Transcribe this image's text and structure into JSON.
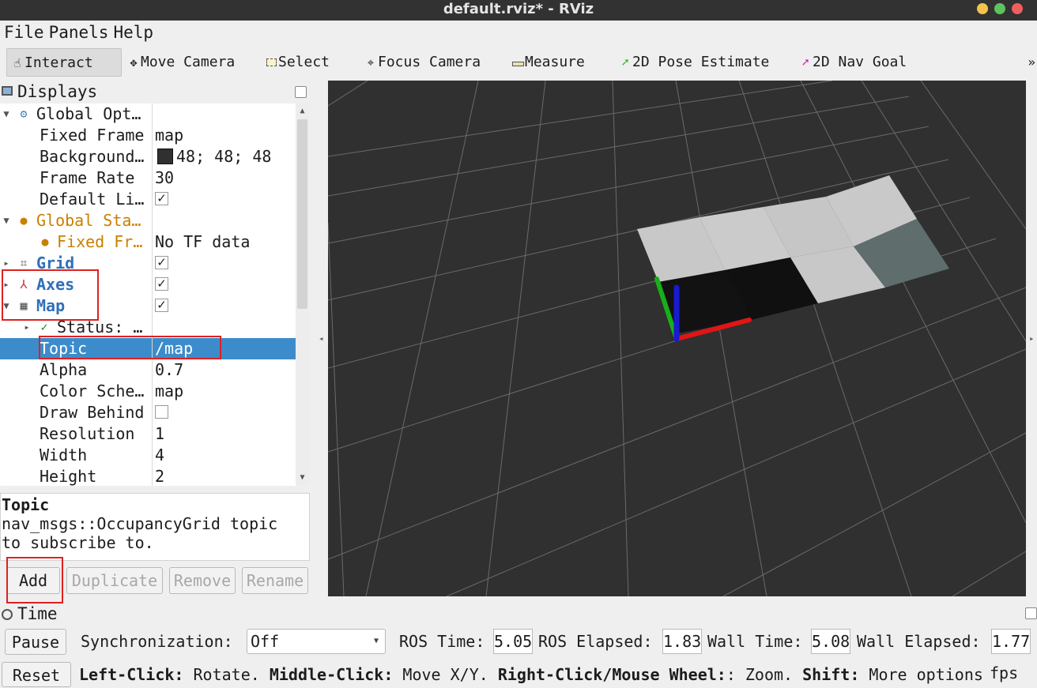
{
  "window": {
    "title": "default.rviz* - RViz"
  },
  "menu": {
    "file_label": "File",
    "panels_label": "Panels",
    "help_label": "Help"
  },
  "toolbar": {
    "interact": "Interact",
    "move_camera": "Move Camera",
    "select": "Select",
    "focus_camera": "Focus Camera",
    "measure": "Measure",
    "pose_estimate": "2D Pose Estimate",
    "nav_goal": "2D Nav Goal",
    "more": "»"
  },
  "displays": {
    "title": "Displays",
    "rows": {
      "global_options": {
        "name": "Global Opt…"
      },
      "fixed_frame": {
        "name": "Fixed Frame",
        "value": "map"
      },
      "background": {
        "name": "Background…",
        "value": "48; 48; 48"
      },
      "frame_rate": {
        "name": "Frame Rate",
        "value": "30"
      },
      "default_light": {
        "name": "Default Li…"
      },
      "global_status": {
        "name": "Global Sta…"
      },
      "fixed_frame_status": {
        "name": "Fixed Fr…",
        "value": "No TF data"
      },
      "grid": {
        "name": "Grid"
      },
      "axes": {
        "name": "Axes"
      },
      "map": {
        "name": "Map"
      },
      "status": {
        "name": "Status: …"
      },
      "topic": {
        "name": "Topic",
        "value": "/map"
      },
      "alpha": {
        "name": "Alpha",
        "value": "0.7"
      },
      "color_scheme": {
        "name": "Color Sche…",
        "value": "map"
      },
      "draw_behind": {
        "name": "Draw Behind"
      },
      "resolution": {
        "name": "Resolution",
        "value": "1"
      },
      "width": {
        "name": "Width",
        "value": "4"
      },
      "height": {
        "name": "Height",
        "value": "2"
      }
    },
    "description": {
      "title": "Topic",
      "text": "nav_msgs::OccupancyGrid topic to subscribe to."
    },
    "buttons": {
      "add": "Add",
      "duplicate": "Duplicate",
      "remove": "Remove",
      "rename": "Rename"
    }
  },
  "time": {
    "title": "Time",
    "pause": "Pause",
    "sync_label": "Synchronization:",
    "sync_value": "Off",
    "ros_time_label": "ROS Time:",
    "ros_time_value": "5.05",
    "ros_elapsed_label": "ROS Elapsed:",
    "ros_elapsed_value": "1.83",
    "wall_time_label": "Wall Time:",
    "wall_time_value": "5.08",
    "wall_elapsed_label": "Wall Elapsed:",
    "wall_elapsed_value": "1.77"
  },
  "status": {
    "reset": "Reset",
    "k1": "Left-Click:",
    "v1": " Rotate. ",
    "k2": "Middle-Click:",
    "v2": " Move X/Y. ",
    "k3": "Right-Click/Mouse Wheel:",
    "v3": ": Zoom. ",
    "k4": "Shift:",
    "v4": " More options.",
    "fps": "fps"
  },
  "colors": {
    "selection": "#3c8ccc",
    "display_blue": "#2f6fb8",
    "warning_orange": "#c88000",
    "viewport_bg": "#303030",
    "annotation_red": "#e02020"
  }
}
